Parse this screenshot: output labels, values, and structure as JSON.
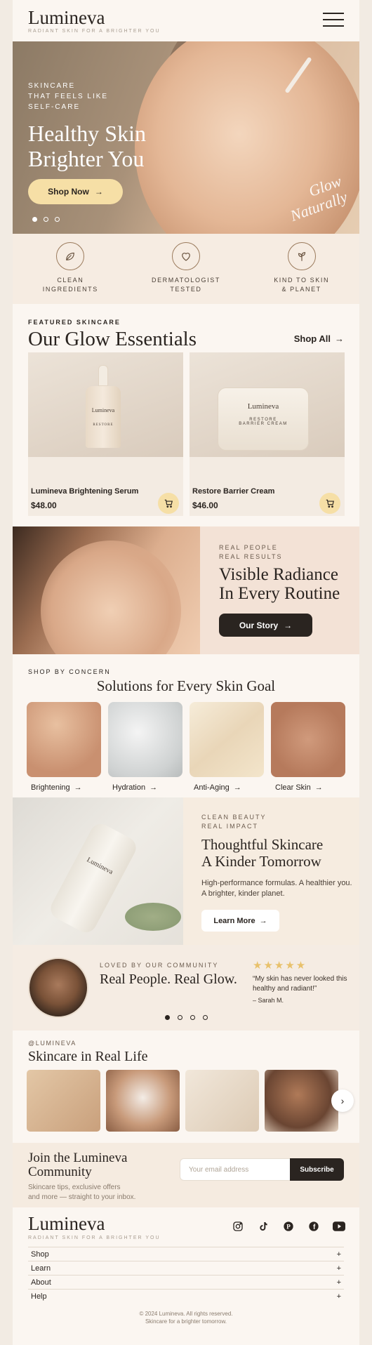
{
  "header": {
    "logo": "Lumineva",
    "tagline": "RADIANT SKIN FOR A BRIGHTER YOU",
    "menu_icon": "hamburger-icon"
  },
  "hero": {
    "eyebrow_1": "SKINCARE",
    "eyebrow_2": "THAT FEELS LIKE",
    "eyebrow_3": "SELF-CARE",
    "title_1": "Healthy Skin",
    "title_2": "Brighter You",
    "button": "Shop Now",
    "script_1": "Glow",
    "script_2": "Naturally",
    "slides": 3,
    "active_slide": 1
  },
  "features": [
    {
      "icon": "leaf-icon",
      "line1": "CLEAN",
      "line2": "INGREDIENTS"
    },
    {
      "icon": "heart-icon",
      "line1": "DERMATOLOGIST",
      "line2": "TESTED"
    },
    {
      "icon": "plant-icon",
      "line1": "KIND TO SKIN",
      "line2": "& PLANET"
    }
  ],
  "essentials": {
    "eyebrow": "FEATURED SKINCARE",
    "title": "Our Glow Essentials",
    "shop_all": "Shop All",
    "products": [
      {
        "name": "Lumineva Brightening Serum",
        "price": "$48.00",
        "label_brand": "Lumineva",
        "label_product": "RESTORE"
      },
      {
        "name": "Restore Barrier Cream",
        "price": "$46.00",
        "label_brand": "Lumineva",
        "label_product_1": "RESTORE",
        "label_product_2": "BARRIER CREAM"
      }
    ]
  },
  "radiance": {
    "eyebrow_1": "REAL PEOPLE",
    "eyebrow_2": "REAL RESULTS",
    "title_1": "Visible Radiance",
    "title_2": "In Every Routine",
    "button": "Our Story"
  },
  "concern": {
    "eyebrow": "SHOP BY CONCERN",
    "title": "Solutions for Every Skin Goal",
    "items": [
      "Brightening",
      "Hydration",
      "Anti-Aging",
      "Clear Skin"
    ]
  },
  "clean": {
    "eyebrow_1": "CLEAN BEAUTY",
    "eyebrow_2": "REAL IMPACT",
    "title_1": "Thoughtful Skincare",
    "title_2": "A Kinder Tomorrow",
    "body": "High-performance formulas. A healthier you. A brighter, kinder planet.",
    "button": "Learn More",
    "bottle_brand": "Lumineva"
  },
  "community": {
    "eyebrow": "LOVED BY OUR COMMUNITY",
    "title": "Real People. Real Glow.",
    "stars": "★★★★★",
    "rating": 5,
    "quote": "“My skin has never looked this healthy and radiant!”",
    "author": "– Sarah M.",
    "slides": 4,
    "active_slide": 1
  },
  "real_life": {
    "handle": "@LUMINEVA",
    "title": "Skincare in Real Life"
  },
  "join": {
    "title_1": "Join the Lumineva",
    "title_2": "Community",
    "sub_1": "Skincare tips, exclusive offers",
    "sub_2": "and more — straight to your inbox.",
    "placeholder": "Your email address",
    "button": "Subscribe"
  },
  "footer": {
    "logo": "Lumineva",
    "tagline": "RADIANT SKIN FOR A BRIGHTER YOU",
    "socials": [
      "instagram-icon",
      "tiktok-icon",
      "pinterest-icon",
      "facebook-icon",
      "youtube-icon"
    ],
    "links": [
      "Shop",
      "Learn",
      "About",
      "Help"
    ],
    "copyright": "© 2024 Lumineva. All rights reserved.",
    "copy_sub": "Skincare for a brighter tomorrow."
  },
  "colors": {
    "accent": "#f6dfa6",
    "dark": "#2a2420",
    "cream": "#fbf6f1",
    "star": "#e8c16b"
  }
}
